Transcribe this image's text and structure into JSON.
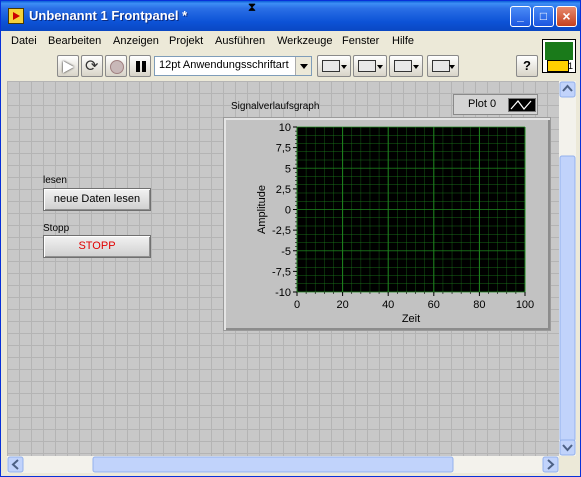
{
  "window": {
    "title": "Unbenannt 1 Frontpanel *",
    "buttons": {
      "minimize": "_",
      "maximize": "□",
      "close": "×"
    }
  },
  "menu": {
    "items": [
      "Datei",
      "Bearbeiten",
      "Anzeigen",
      "Projekt",
      "Ausführen",
      "Werkzeuge",
      "Fenster",
      "Hilfe"
    ]
  },
  "toolbar": {
    "font_select": "12pt Anwendungsschriftart",
    "help_label": "?"
  },
  "vi_icon": {
    "number": "1"
  },
  "controls": {
    "read": {
      "label": "lesen",
      "button_text": "neue Daten lesen"
    },
    "stop": {
      "label": "Stopp",
      "button_text": "STOPP",
      "text_color": "#e00000"
    }
  },
  "graph": {
    "label": "Signalverlaufsgraph",
    "legend_plot_name": "Plot 0",
    "xlabel": "Zeit",
    "ylabel": "Amplitude",
    "plot_bg": "#000000",
    "grid_color": "#1f8a1f"
  },
  "chart_data": {
    "type": "line",
    "title": "Signalverlaufsgraph",
    "xlabel": "Zeit",
    "ylabel": "Amplitude",
    "xlim": [
      0,
      100
    ],
    "ylim": [
      -10,
      10
    ],
    "x_ticks": [
      "0",
      "20",
      "40",
      "60",
      "80",
      "100"
    ],
    "y_ticks": [
      "10",
      "7,5",
      "5",
      "2,5",
      "0",
      "-2,5",
      "-5",
      "-7,5",
      "-10"
    ],
    "series": [
      {
        "name": "Plot 0",
        "values": []
      }
    ],
    "grid": true,
    "legend": "top-right"
  },
  "colors": {
    "titlebar": "#0a47c2",
    "panel": "#c8c8c8",
    "stop_text": "#e00000"
  }
}
